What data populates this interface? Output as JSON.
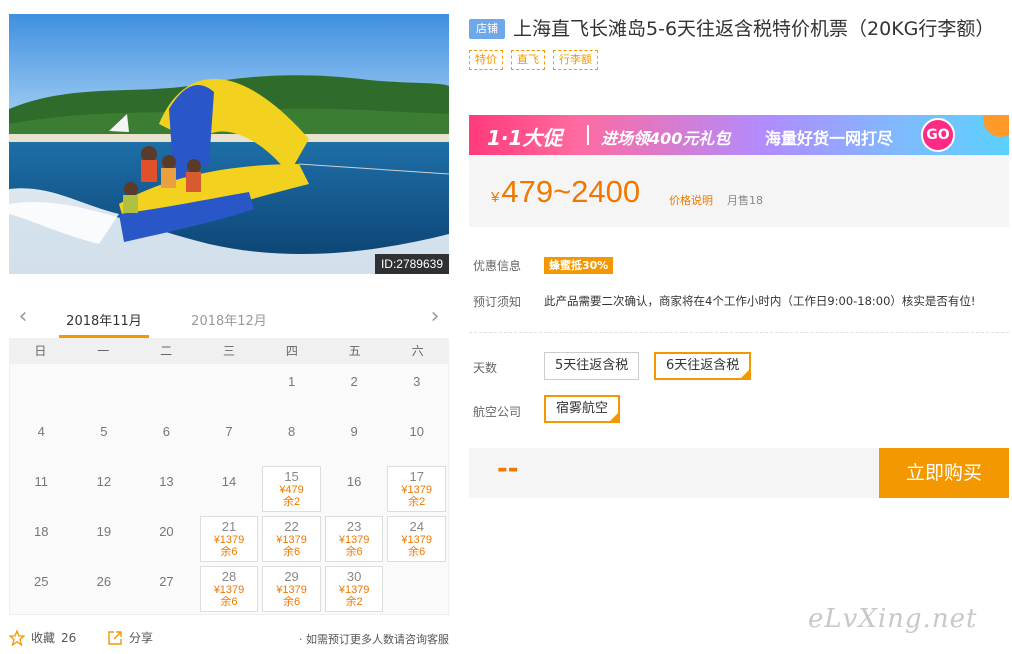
{
  "photo": {
    "id_label": "ID:2789639"
  },
  "calendar": {
    "months": [
      "2018年11月",
      "2018年12月"
    ],
    "active_month": 0,
    "weekdays": [
      "日",
      "一",
      "二",
      "三",
      "四",
      "五",
      "六"
    ],
    "leading_blanks": 4,
    "days": [
      {
        "d": "1"
      },
      {
        "d": "2"
      },
      {
        "d": "3"
      },
      {
        "d": "4"
      },
      {
        "d": "5"
      },
      {
        "d": "6"
      },
      {
        "d": "7"
      },
      {
        "d": "8"
      },
      {
        "d": "9"
      },
      {
        "d": "10"
      },
      {
        "d": "11"
      },
      {
        "d": "12"
      },
      {
        "d": "13"
      },
      {
        "d": "14"
      },
      {
        "d": "15",
        "price": "¥479",
        "left": "余2"
      },
      {
        "d": "16"
      },
      {
        "d": "17",
        "price": "¥1379",
        "left": "余2"
      },
      {
        "d": "18"
      },
      {
        "d": "19"
      },
      {
        "d": "20"
      },
      {
        "d": "21",
        "price": "¥1379",
        "left": "余6"
      },
      {
        "d": "22",
        "price": "¥1379",
        "left": "余6"
      },
      {
        "d": "23",
        "price": "¥1379",
        "left": "余6"
      },
      {
        "d": "24",
        "price": "¥1379",
        "left": "余6"
      },
      {
        "d": "25"
      },
      {
        "d": "26"
      },
      {
        "d": "27"
      },
      {
        "d": "28",
        "price": "¥1379",
        "left": "余6"
      },
      {
        "d": "29",
        "price": "¥1379",
        "left": "余6"
      },
      {
        "d": "30",
        "price": "¥1379",
        "left": "余2"
      }
    ]
  },
  "footer": {
    "favorite_label": "收藏",
    "favorite_count": "26",
    "share_label": "分享",
    "tip": "· 如需预订更多人数请咨询客服"
  },
  "product": {
    "store_badge": "店铺",
    "title": "上海直飞长滩岛5-6天往返含税特价机票（20KG行李额）",
    "tags": [
      "特价",
      "直飞",
      "行李额"
    ]
  },
  "banner": {
    "promo": "1·1大促",
    "coupon": "进场领400元礼包",
    "slogan": "海量好货一网打尽",
    "go": "GO"
  },
  "price": {
    "currency": "¥",
    "range": "479~2400",
    "note_link": "价格说明",
    "sales": "月售18"
  },
  "info": {
    "discount_label": "优惠信息",
    "discount_badge": "蜂蜜抵30%",
    "booking_label": "预订须知",
    "booking_text": "此产品需要二次确认，商家将在4个工作小时内（工作日9:00-18:00）核实是否有位!"
  },
  "options": {
    "days_label": "天数",
    "days": [
      "5天往返含税",
      "6天往返含税"
    ],
    "days_selected": 1,
    "airline_label": "航空公司",
    "airline": "宿雾航空"
  },
  "buy": {
    "total": "--",
    "button": "立即购买"
  },
  "watermark": "eLvXing.net",
  "colors": {
    "accent": "#f39800",
    "price": "#f07800",
    "store": "#6ea8e8"
  }
}
